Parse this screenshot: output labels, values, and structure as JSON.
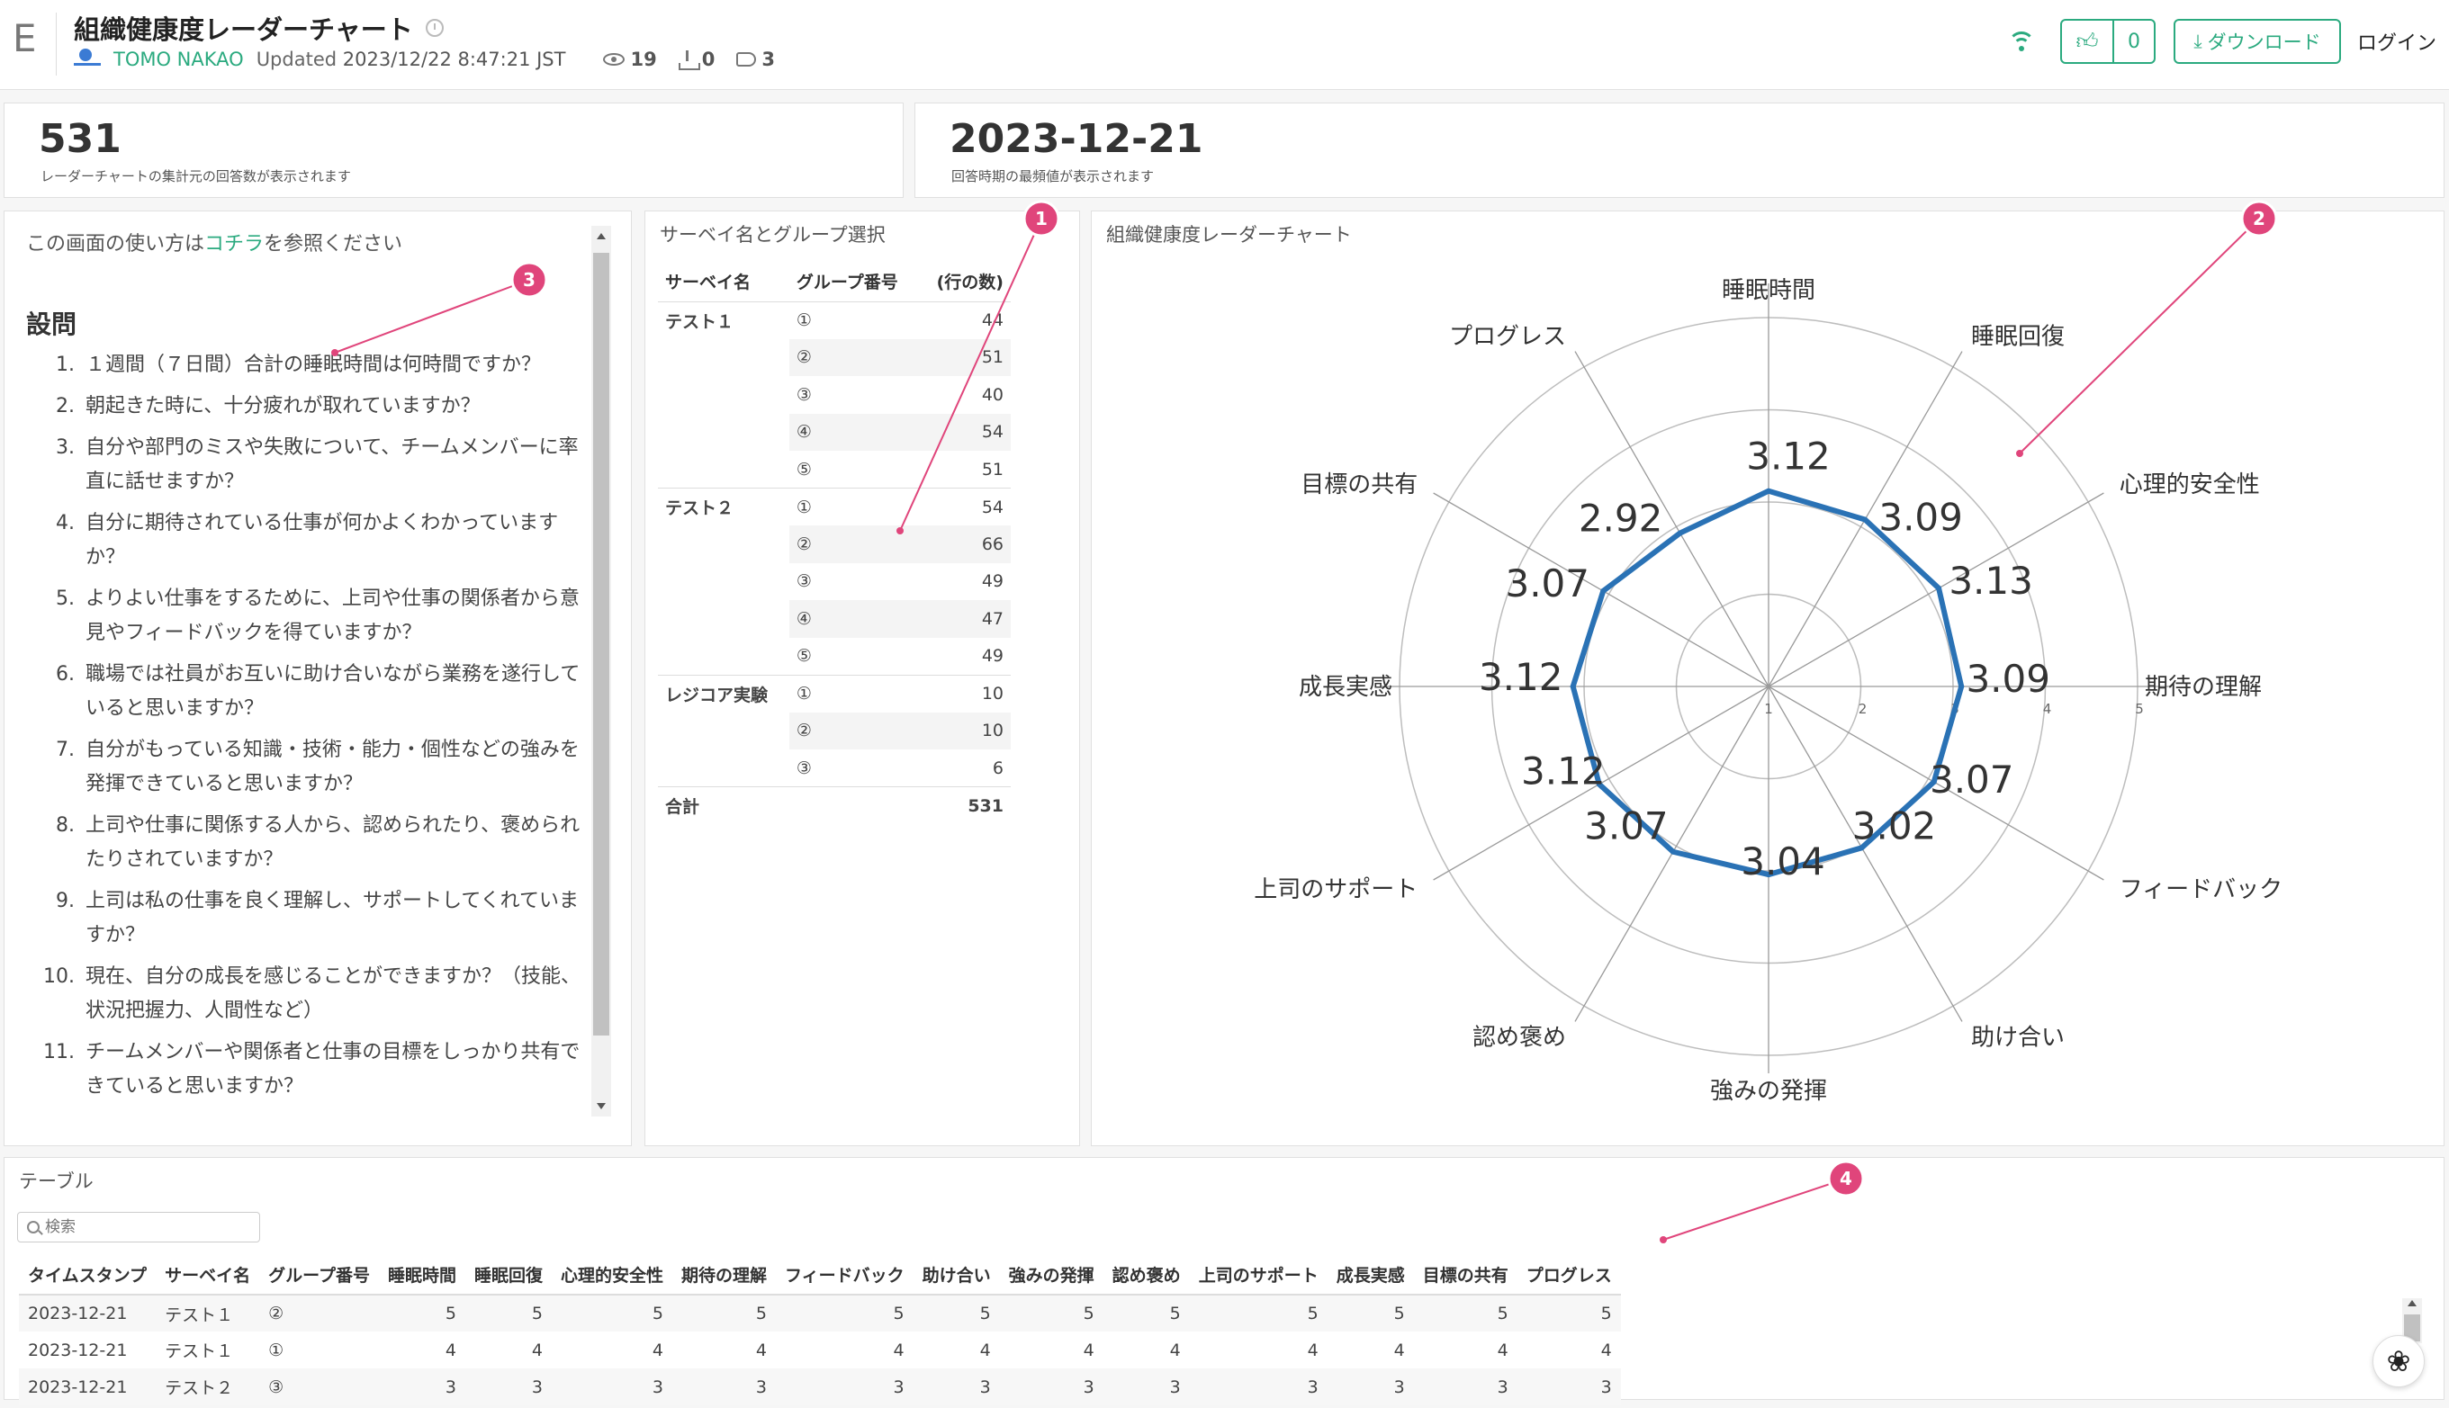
{
  "header": {
    "logo_letter": "E",
    "title": "組織健康度レーダーチャート",
    "author": "TOMO NAKAO",
    "updated_label": "Updated",
    "updated_value": "2023/12/22 8:47:21 JST",
    "views": "19",
    "downloads": "0",
    "tags": "3",
    "likes": "0",
    "download_label": "ダウンロード",
    "login_label": "ログイン"
  },
  "kpis": [
    {
      "value": "531",
      "desc": "レーダーチャートの集計元の回答数が表示されます"
    },
    {
      "value": "2023-12-21",
      "desc": "回答時期の最頻値が表示されます"
    }
  ],
  "questions": {
    "intro_pre": "この画面の使い方は",
    "intro_link": "コチラ",
    "intro_post": "を参照ください",
    "heading": "設問",
    "items": [
      "１週間（７日間）合計の睡眠時間は何時間ですか？",
      "朝起きた時に、十分疲れが取れていますか？",
      "自分や部門のミスや失敗について、チームメンバーに率直に話せますか？",
      "自分に期待されている仕事が何かよくわかっていますか？",
      "よりよい仕事をするために、上司や仕事の関係者から意見やフィードバックを得ていますか？",
      "職場では社員がお互いに助け合いながら業務を遂行していると思いますか？",
      "自分がもっている知識・技術・能力・個性などの強みを発揮できていると思いますか？",
      "上司や仕事に関係する人から、認められたり、褒められたりされていますか？",
      "上司は私の仕事を良く理解し、サポートしてくれていますか？",
      "現在、自分の成長を感じることができますか？（技能、状況把握力、人間性など）",
      "チームメンバーや関係者と仕事の目標をしっかり共有できていると思いますか？"
    ]
  },
  "survey": {
    "title": "サーベイ名とグループ選択",
    "headers": [
      "サーベイ名",
      "グループ番号",
      "(行の数)"
    ],
    "groups": [
      {
        "name": "テスト１",
        "rows": [
          {
            "grp": "①",
            "count": "44"
          },
          {
            "grp": "②",
            "count": "51"
          },
          {
            "grp": "③",
            "count": "40"
          },
          {
            "grp": "④",
            "count": "54"
          },
          {
            "grp": "⑤",
            "count": "51"
          }
        ]
      },
      {
        "name": "テスト２",
        "rows": [
          {
            "grp": "①",
            "count": "54"
          },
          {
            "grp": "②",
            "count": "66"
          },
          {
            "grp": "③",
            "count": "49"
          },
          {
            "grp": "④",
            "count": "47"
          },
          {
            "grp": "⑤",
            "count": "49"
          }
        ]
      },
      {
        "name": "レジコア実験",
        "rows": [
          {
            "grp": "①",
            "count": "10"
          },
          {
            "grp": "②",
            "count": "10"
          },
          {
            "grp": "③",
            "count": "6"
          }
        ]
      }
    ],
    "total_label": "合計",
    "total_value": "531"
  },
  "radar": {
    "title": "組織健康度レーダーチャート"
  },
  "chart_data": {
    "type": "radar",
    "categories": [
      "睡眠時間",
      "睡眠回復",
      "心理的安全性",
      "期待の理解",
      "フィードバック",
      "助け合い",
      "強みの発揮",
      "認め褒め",
      "上司のサポート",
      "成長実感",
      "目標の共有",
      "プログレス"
    ],
    "values": [
      3.12,
      3.09,
      3.13,
      3.09,
      3.07,
      3.02,
      3.04,
      3.07,
      3.12,
      3.12,
      3.07,
      2.92
    ],
    "value_labels": [
      "3.12",
      "3.09",
      "3.13",
      "3.09",
      "3.07",
      "3.02",
      "3.04",
      "3.07",
      "3.12",
      "3.12",
      "3.07",
      "2.92"
    ],
    "rmin": 1,
    "rmax": 5,
    "ticks": [
      "1",
      "2",
      "3",
      "4",
      "5"
    ],
    "series_color": "#2a72b5"
  },
  "table": {
    "title": "テーブル",
    "search_placeholder": "検索",
    "columns": [
      "タイムスタンプ",
      "サーベイ名",
      "グループ番号",
      "睡眠時間",
      "睡眠回復",
      "心理的安全性",
      "期待の理解",
      "フィードバック",
      "助け合い",
      "強みの発揮",
      "認め褒め",
      "上司のサポート",
      "成長実感",
      "目標の共有",
      "プログレス"
    ],
    "rows": [
      [
        "2023-12-21",
        "テスト１",
        "②",
        "5",
        "5",
        "5",
        "5",
        "5",
        "5",
        "5",
        "5",
        "5",
        "5",
        "5",
        "5"
      ],
      [
        "2023-12-21",
        "テスト１",
        "①",
        "4",
        "4",
        "4",
        "4",
        "4",
        "4",
        "4",
        "4",
        "4",
        "4",
        "4",
        "4"
      ],
      [
        "2023-12-21",
        "テスト２",
        "③",
        "3",
        "3",
        "3",
        "3",
        "3",
        "3",
        "3",
        "3",
        "3",
        "3",
        "3",
        "3"
      ]
    ]
  },
  "annotations": [
    "1",
    "2",
    "3",
    "4"
  ],
  "colors": {
    "accent": "#2baa7f",
    "annotation": "#e0457b"
  }
}
